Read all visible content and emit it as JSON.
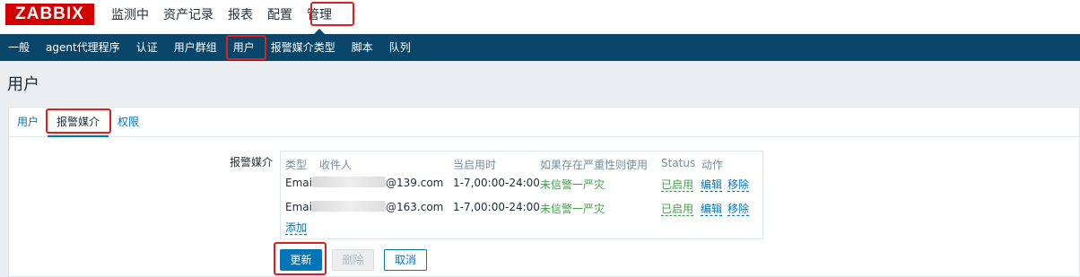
{
  "logo": "ZABBIX",
  "top_menu": [
    "监测中",
    "资产记录",
    "报表",
    "配置",
    "管理"
  ],
  "sub_menu": [
    "一般",
    "agent代理程序",
    "认证",
    "用户群组",
    "用户",
    "报警媒介类型",
    "脚本",
    "队列"
  ],
  "page_title": "用户",
  "tabs": [
    "用户",
    "报警媒介",
    "权限"
  ],
  "media": {
    "label": "报警媒介",
    "headers": [
      "类型",
      "收件人",
      "当启用时",
      "如果存在严重性则使用",
      "Status",
      "动作"
    ],
    "rows": [
      {
        "type": "Email",
        "recipient_suffix": "@139.com",
        "when_active": "1-7,00:00-24:00",
        "severity": "未信警一严灾",
        "status": "已启用",
        "edit": "编辑",
        "remove": "移除"
      },
      {
        "type": "Email",
        "recipient_suffix": "@163.com",
        "when_active": "1-7,00:00-24:00",
        "severity": "未信警一严灾",
        "status": "已启用",
        "edit": "编辑",
        "remove": "移除"
      }
    ],
    "add": "添加"
  },
  "buttons": {
    "update": "更新",
    "delete": "删除",
    "cancel": "取消"
  },
  "colors": {
    "brand_red": "#d40000",
    "nav_dark": "#0a466a",
    "link_blue": "#0275b8",
    "enabled_green": "#429e47",
    "highlight_red": "#e01e1e"
  }
}
